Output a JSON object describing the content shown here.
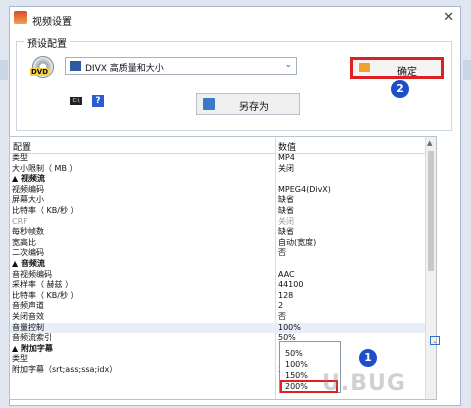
{
  "window": {
    "title": "视频设置"
  },
  "preset": {
    "group_label": "预设配置",
    "selected": "DIVX 高质量和大小",
    "ok_label": "确定",
    "saveas_label": "另存为",
    "dvd_label": "DVD"
  },
  "badges": [
    "1",
    "2"
  ],
  "grid": {
    "col_config": "配置",
    "col_value": "数值",
    "rows": [
      {
        "k": "类型",
        "v": "MP4"
      },
      {
        "k": "大小限制（ MB ）",
        "v": "关闭"
      },
      {
        "k": "▲ 视频流",
        "v": ""
      },
      {
        "k": "    视频编码",
        "v": "MPEG4(DivX)"
      },
      {
        "k": "    屏幕大小",
        "v": "缺省"
      },
      {
        "k": "    比特率（ KB/秒 ）",
        "v": "缺省"
      },
      {
        "k": "    CRF",
        "v": "关闭"
      },
      {
        "k": "    每秒帧数",
        "v": "缺省"
      },
      {
        "k": "    宽高比",
        "v": "自动(宽度)"
      },
      {
        "k": "    二次编码",
        "v": "否"
      },
      {
        "k": "▲ 音频流",
        "v": ""
      },
      {
        "k": "    音视频编码",
        "v": "AAC"
      },
      {
        "k": "    采样率（ 赫兹 ）",
        "v": "44100"
      },
      {
        "k": "    比特率（ KB/秒 ）",
        "v": "128"
      },
      {
        "k": "    音频声道",
        "v": "2"
      },
      {
        "k": "    关闭音效",
        "v": "否"
      },
      {
        "k": "    音量控制",
        "v": "100%"
      },
      {
        "k": "    音频流索引",
        "v": "50%"
      },
      {
        "k": "▲ 附加字幕",
        "v": "100%"
      },
      {
        "k": "    类型",
        "v": "150%"
      },
      {
        "k": "    附加字幕（srt;ass;ssa;idx）",
        "v": "200%"
      }
    ]
  },
  "dropdown": {
    "options": [
      "50%",
      "100%",
      "150%",
      "200%"
    ]
  },
  "watermark": "U.BUG"
}
